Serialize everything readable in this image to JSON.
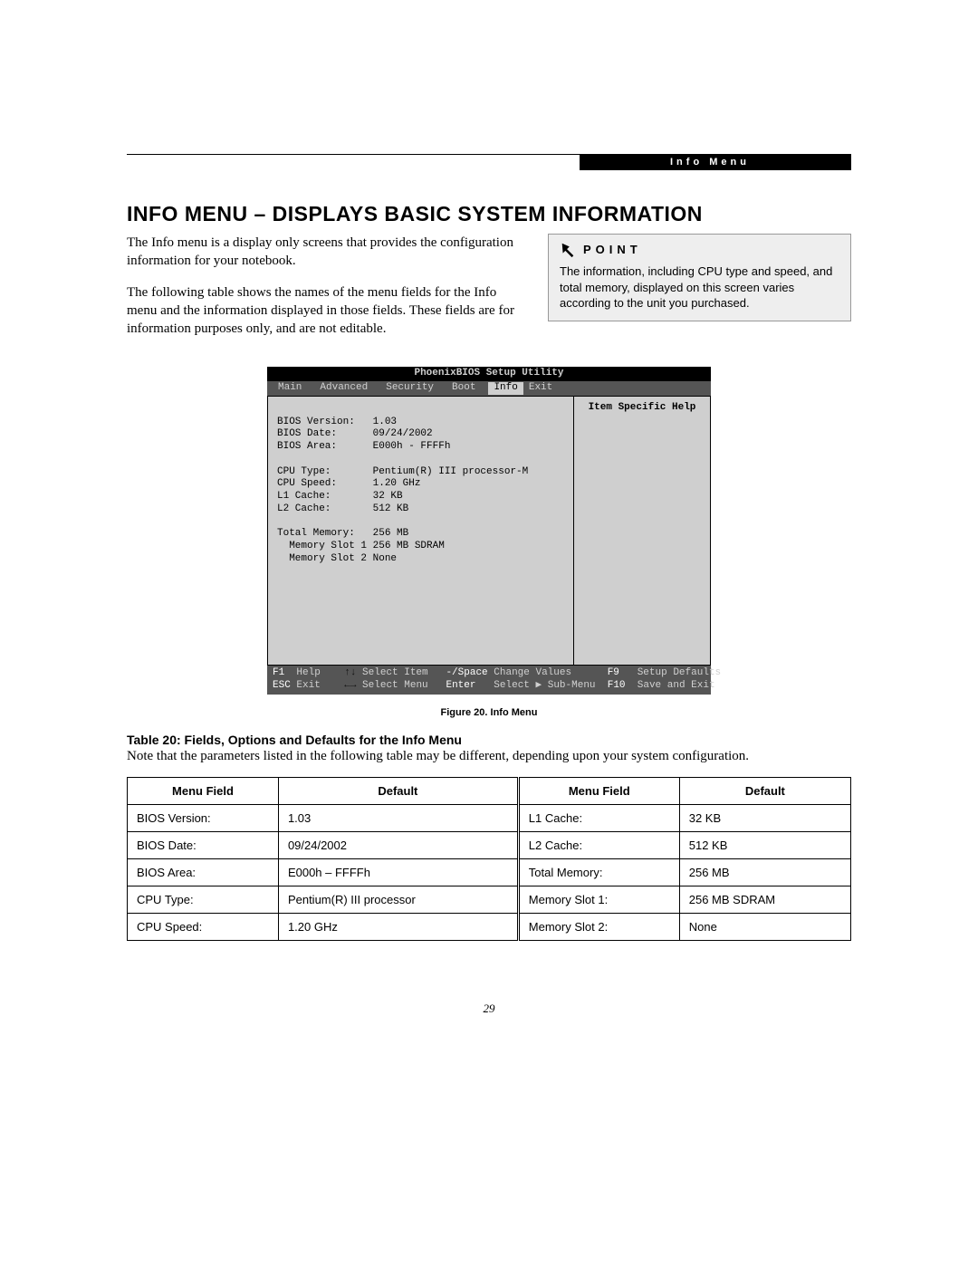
{
  "header": {
    "section": "Info Menu"
  },
  "title": "INFO MENU – DISPLAYS BASIC SYSTEM INFORMATION",
  "intro": {
    "p1": "The Info menu is a display only screens that provides the configuration information for your notebook.",
    "p2": "The following table shows the names of the menu fields for the Info menu and the information displayed in those fields. These fields are for information purposes only, and are not editable."
  },
  "point": {
    "label": "POINT",
    "text": "The information, including CPU type and speed, and total memory, displayed on this screen varies according to the unit you purchased."
  },
  "bios": {
    "title": "PhoenixBIOS Setup Utility",
    "menu": [
      "Main",
      "Advanced",
      "Security",
      "Boot",
      "Info",
      "Exit"
    ],
    "selected": "Info",
    "help_title": "Item Specific Help",
    "fields": [
      {
        "label": "BIOS Version:",
        "value": "1.03"
      },
      {
        "label": "BIOS Date:",
        "value": "09/24/2002"
      },
      {
        "label": "BIOS Area:",
        "value": "E000h - FFFFh"
      },
      {
        "label": "",
        "value": ""
      },
      {
        "label": "CPU Type:",
        "value": "Pentium(R) III processor-M"
      },
      {
        "label": "CPU Speed:",
        "value": "1.20 GHz"
      },
      {
        "label": "L1 Cache:",
        "value": "32 KB"
      },
      {
        "label": "L2 Cache:",
        "value": "512 KB"
      },
      {
        "label": "",
        "value": ""
      },
      {
        "label": "Total Memory:",
        "value": "256 MB"
      },
      {
        "label": "  Memory Slot 1:",
        "value": "256 MB SDRAM"
      },
      {
        "label": "  Memory Slot 2:",
        "value": "None"
      }
    ],
    "footer": {
      "l1_a": "F1",
      "l1_b": "Help",
      "l1_c": "↑↓",
      "l1_d": "Select Item",
      "l1_e": "-/Space",
      "l1_f": "Change Values",
      "l1_g": "F9",
      "l1_h": "Setup Defaults",
      "l2_a": "ESC",
      "l2_b": "Exit",
      "l2_c": "←→",
      "l2_d": "Select Menu",
      "l2_e": "Enter",
      "l2_f": "Select ▶ Sub-Menu",
      "l2_g": "F10",
      "l2_h": "Save and Exit"
    }
  },
  "figure_caption": "Figure 20.   Info Menu",
  "table_title": "Table 20: Fields, Options and Defaults for the Info Menu",
  "table_note": "Note that the parameters listed in the following table may be different, depending upon your system configuration.",
  "table": {
    "headers": [
      "Menu Field",
      "Default",
      "Menu Field",
      "Default"
    ],
    "rows": [
      [
        "BIOS Version:",
        "1.03",
        "L1 Cache:",
        "32 KB"
      ],
      [
        "BIOS Date:",
        "09/24/2002",
        "L2 Cache:",
        "512 KB"
      ],
      [
        "BIOS Area:",
        "E000h – FFFFh",
        "Total Memory:",
        "256 MB"
      ],
      [
        "CPU Type:",
        "Pentium(R) III processor",
        "Memory Slot 1:",
        "256 MB SDRAM"
      ],
      [
        "CPU Speed:",
        "1.20 GHz",
        "Memory Slot 2:",
        "None"
      ]
    ]
  },
  "page_number": "29"
}
